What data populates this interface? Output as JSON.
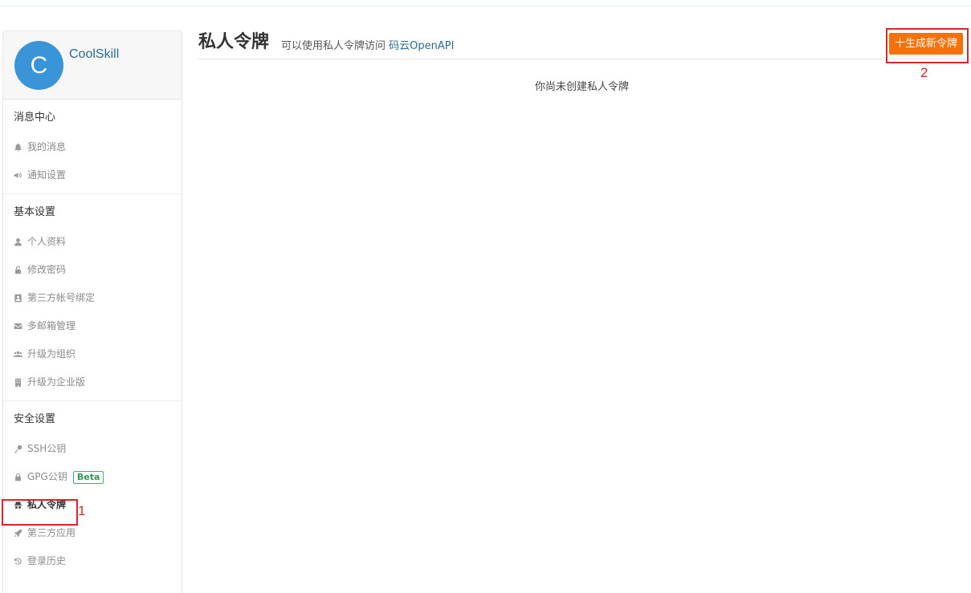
{
  "profile": {
    "avatar_letter": "C",
    "username": "CoolSkill"
  },
  "sidebar": {
    "groups": [
      {
        "title": "消息中心",
        "items": [
          {
            "label": "我的消息",
            "icon": "bell-icon"
          },
          {
            "label": "通知设置",
            "icon": "speaker-icon"
          }
        ]
      },
      {
        "title": "基本设置",
        "items": [
          {
            "label": "个人资料",
            "icon": "user-icon"
          },
          {
            "label": "修改密码",
            "icon": "unlock-icon"
          },
          {
            "label": "第三方帐号绑定",
            "icon": "contact-card-icon"
          },
          {
            "label": "多邮箱管理",
            "icon": "envelope-icon"
          },
          {
            "label": "升级为组织",
            "icon": "users-icon"
          },
          {
            "label": "升级为企业版",
            "icon": "building-icon"
          }
        ]
      },
      {
        "title": "安全设置",
        "items": [
          {
            "label": "SSH公钥",
            "icon": "key-icon"
          },
          {
            "label": "GPG公钥",
            "icon": "lock-icon",
            "badge": "Beta"
          },
          {
            "label": "私人令牌",
            "icon": "spy-icon",
            "active": true
          },
          {
            "label": "第三方应用",
            "icon": "rocket-icon"
          },
          {
            "label": "登录历史",
            "icon": "history-icon"
          }
        ]
      }
    ]
  },
  "main": {
    "title": "私人令牌",
    "subtitle_prefix": "可以使用私人令牌访问",
    "subtitle_link": "码云OpenAPI",
    "generate_button": "十生成新令牌",
    "empty_text": "你尚未创建私人令牌"
  },
  "annotations": [
    {
      "number": "1",
      "target": "私人令牌"
    },
    {
      "number": "2",
      "target": "十生成新令牌"
    }
  ],
  "colors": {
    "accent": "#f5720a",
    "highlight": "#d9262a",
    "link": "#2a6b8f",
    "avatar": "#3a95d8"
  }
}
